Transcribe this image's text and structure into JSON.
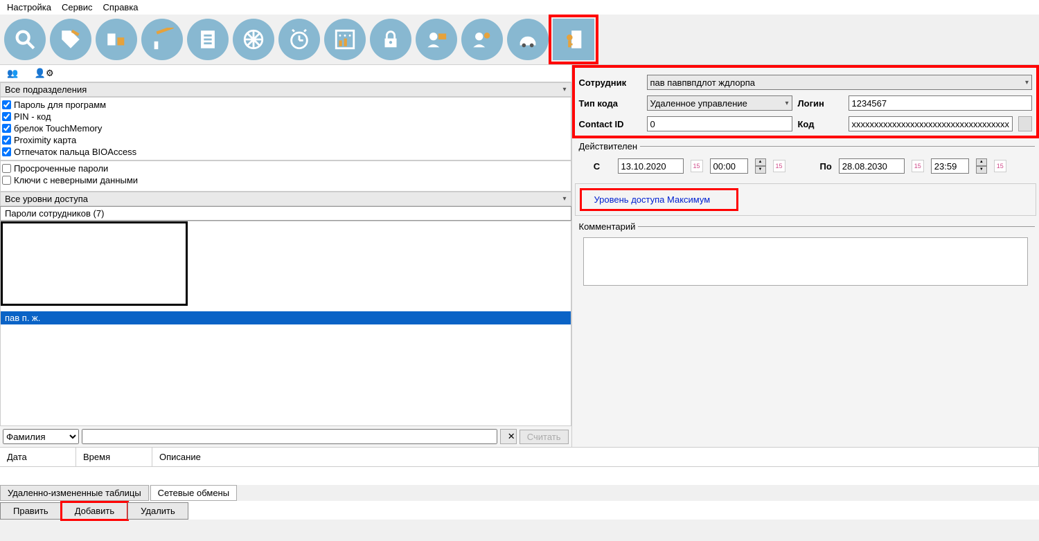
{
  "menu": {
    "settings": "Настройка",
    "service": "Сервис",
    "help": "Справка"
  },
  "left": {
    "dept_dropdown": "Все подразделения",
    "checks1": [
      {
        "label": "Пароль для программ",
        "checked": true
      },
      {
        "label": "PIN - код",
        "checked": true
      },
      {
        "label": "брелок TouchMemory",
        "checked": true
      },
      {
        "label": "Proximity карта",
        "checked": true
      },
      {
        "label": "Отпечаток пальца BIOAccess",
        "checked": true
      }
    ],
    "checks2": [
      {
        "label": "Просроченные пароли",
        "checked": false
      },
      {
        "label": "Ключи с неверными данными",
        "checked": false
      }
    ],
    "levels_dropdown": "Все уровни доступа",
    "passwords_head": "Пароли сотрудников  (7)",
    "selected_emp": "пав п. ж.",
    "search_field": "Фамилия",
    "clear": "✕",
    "read_btn": "Считать"
  },
  "right": {
    "emp_label": "Сотрудник",
    "emp_value": "пав павпвпдлот ждлорпа",
    "codetype_label": "Тип кода",
    "codetype_value": "Удаленное управление",
    "login_label": "Логин",
    "login_value": "1234567",
    "contact_label": "Contact ID",
    "contact_value": "0",
    "code_label": "Код",
    "code_value": "xxxxxxxxxxxxxxxxxxxxxxxxxxxxxxxxxxx",
    "valid_legend": "Действителен",
    "from": "С",
    "from_date": "13.10.2020",
    "from_time": "00:00",
    "to": "По",
    "to_date": "28.08.2030",
    "to_time": "23:59",
    "access_level": "Уровень доступа  Максимум",
    "comment_label": "Комментарий"
  },
  "grid": {
    "c1": "Дата",
    "c2": "Время",
    "c3": "Описание"
  },
  "btabs": {
    "t1": "Удаленно-измененные таблицы",
    "t2": "Сетевые обмены"
  },
  "bbtns": {
    "b1": "Править",
    "b2": "Добавить",
    "b3": "Удалить"
  }
}
